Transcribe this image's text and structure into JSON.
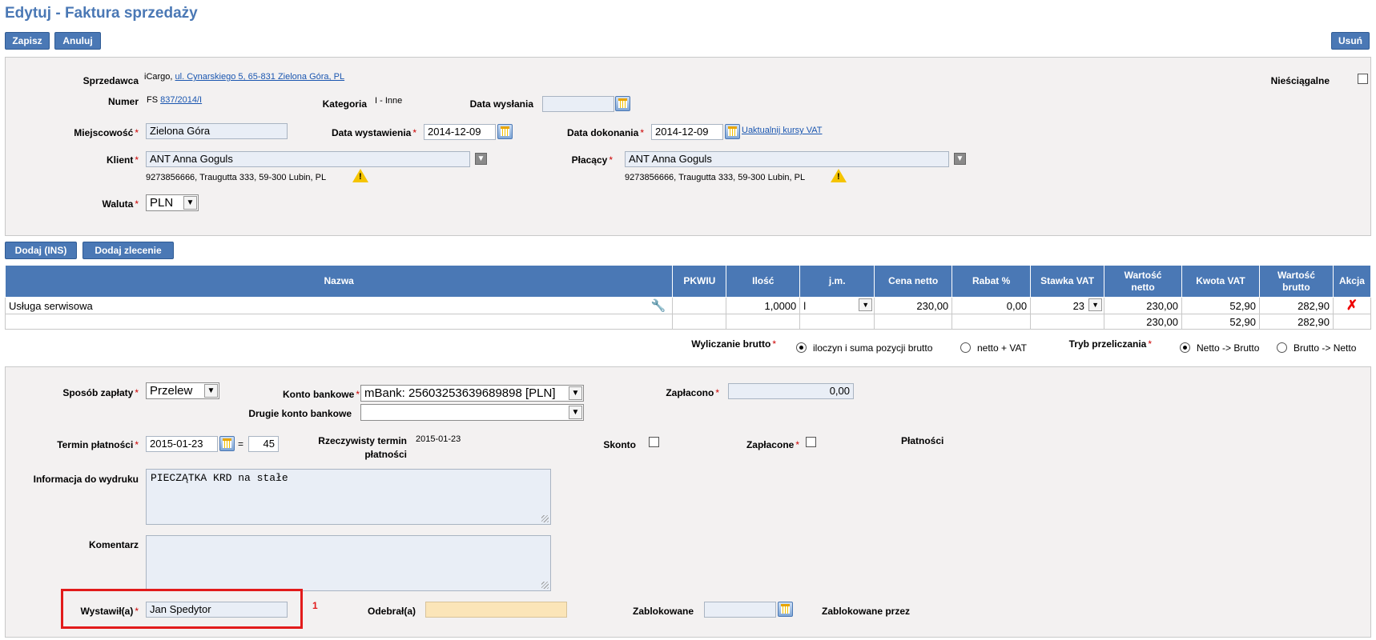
{
  "page": {
    "title": "Edytuj - Faktura sprzedaży"
  },
  "toolbar": {
    "save": "Zapisz",
    "cancel": "Anuluj",
    "delete": "Usuń"
  },
  "header": {
    "seller_label": "Sprzedawca",
    "seller_name": "iCargo,",
    "seller_address": "ul. Cynarskiego 5, 65-831 Zielona Góra, PL",
    "uncollectible_label": "Nieściągalne",
    "number_label": "Numer",
    "number_prefix": "FS",
    "number_value": "837/2014/I",
    "category_label": "Kategoria",
    "category_value": "I - Inne",
    "send_date_label": "Data wysłania",
    "send_date_value": "",
    "city_label": "Miejscowość",
    "city_value": "Zielona Góra",
    "issue_date_label": "Data wystawienia",
    "issue_date_value": "2014-12-09",
    "completion_date_label": "Data dokonania",
    "completion_date_value": "2014-12-09",
    "update_vat_link": "Uaktualnij kursy VAT",
    "client_label": "Klient",
    "client_value": "ANT Anna Goguls",
    "client_details": "9273856666, Traugutta 333, 59-300 Lubin, PL",
    "payer_label": "Płacący",
    "payer_value": "ANT Anna Goguls",
    "payer_details": "9273856666, Traugutta 333, 59-300 Lubin, PL",
    "currency_label": "Waluta",
    "currency_value": "PLN"
  },
  "items_toolbar": {
    "add": "Dodaj (INS)",
    "add_order": "Dodaj zlecenie"
  },
  "items_table": {
    "columns": [
      "Nazwa",
      "PKWIU",
      "Ilość",
      "j.m.",
      "Cena netto",
      "Rabat %",
      "Stawka VAT",
      "Wartość netto",
      "Kwota VAT",
      "Wartość brutto",
      "Akcja"
    ],
    "rows": [
      {
        "name": "Usługa serwisowa",
        "pkwiu": "",
        "qty": "1,0000",
        "unit": "l",
        "price": "230,00",
        "discount": "0,00",
        "vat_rate": "23",
        "net": "230,00",
        "vat": "52,90",
        "gross": "282,90"
      }
    ],
    "totals": {
      "net": "230,00",
      "vat": "52,90",
      "gross": "282,90"
    }
  },
  "calc": {
    "gross_calc_label": "Wyliczanie brutto",
    "opt_product_sum": "iloczyn i suma pozycji brutto",
    "opt_net_vat": "netto + VAT",
    "recalc_mode_label": "Tryb przeliczania",
    "opt_net_gross": "Netto -> Brutto",
    "opt_gross_net": "Brutto -> Netto"
  },
  "payment": {
    "method_label": "Sposób zapłaty",
    "method_value": "Przelew",
    "bank_label": "Konto bankowe",
    "bank_value": "mBank: 25603253639689898 [PLN]",
    "second_bank_label": "Drugie konto bankowe",
    "second_bank_value": "",
    "paid_label": "Zapłacono",
    "paid_value": "0,00",
    "due_label": "Termin płatności",
    "due_value": "2015-01-23",
    "due_eq": "=",
    "due_days": "45",
    "actual_due_label_1": "Rzeczywisty termin",
    "actual_due_label_2": "płatności",
    "actual_due_value": "2015-01-23",
    "discount_label": "Skonto",
    "paid_flag_label": "Zapłacone",
    "payments_label": "Płatności",
    "print_info_label": "Informacja do wydruku",
    "print_info_value": "PIECZĄTKA  KRD na stałe",
    "comment_label": "Komentarz",
    "comment_value": "",
    "issuer_label": "Wystawił(a)",
    "issuer_value": "Jan Spedytor",
    "annotation_num": "1",
    "receiver_label": "Odebrał(a)",
    "receiver_value": "",
    "locked_label": "Zablokowane",
    "locked_value": "",
    "locked_by_label": "Zablokowane przez"
  }
}
